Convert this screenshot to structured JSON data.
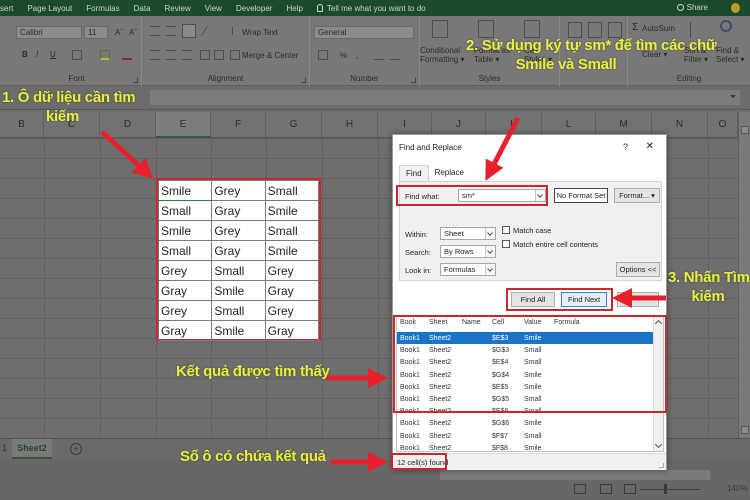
{
  "menubar": {
    "tabs": [
      "sert",
      "Page Layout",
      "Formulas",
      "Data",
      "Review",
      "View",
      "Developer",
      "Help"
    ],
    "tell_me": "Tell me what you want to do",
    "share": "Share"
  },
  "ribbon": {
    "font": {
      "name": "Calibri",
      "size": "11",
      "group_label": "Font",
      "bold": "B",
      "italic": "I",
      "underline": "U",
      "grow": "Aˆ",
      "shrink": "Aˇ"
    },
    "alignment": {
      "wrap_text": "Wrap Text",
      "merge_center": "Merge & Center",
      "group_label": "Alignment"
    },
    "number": {
      "format": "General",
      "percent": "%",
      "comma": ",",
      "group_label": "Number"
    },
    "styles": {
      "conditional_formatting": [
        "Conditional",
        "Formatting ▾"
      ],
      "format_as_table": [
        "Format as",
        "Table ▾"
      ],
      "cell_styles": [
        "Cell",
        "Styles ▾"
      ],
      "group_label": "Styles"
    },
    "editing": {
      "autosum": "AutoSum",
      "clear": "Clear ▾",
      "sort_filter": [
        "Sort &",
        "Filter ▾"
      ],
      "find_select": [
        "Find &",
        "Select ▾"
      ],
      "group_label": "Editing"
    }
  },
  "grid": {
    "columns": [
      "B",
      "C",
      "D",
      "E",
      "F",
      "G",
      "H",
      "I",
      "J",
      "K",
      "L",
      "M",
      "N",
      "O"
    ],
    "selected_column": "E",
    "data": [
      [
        "Smile",
        "Grey",
        "Small"
      ],
      [
        "Small",
        "Gray",
        "Smile"
      ],
      [
        "Smile",
        "Grey",
        "Small"
      ],
      [
        "Small",
        "Gray",
        "Smile"
      ],
      [
        "Grey",
        "Small",
        "Grey"
      ],
      [
        "Gray",
        "Smile",
        "Gray"
      ],
      [
        "Grey",
        "Small",
        "Grey"
      ],
      [
        "Gray",
        "Smile",
        "Gray"
      ]
    ]
  },
  "sheet_tabs": {
    "active": "Sheet2",
    "prev_fragment": "1",
    "add": "+"
  },
  "status": {
    "zoom": "140%"
  },
  "dialog": {
    "title": "Find and Replace",
    "help": "?",
    "close": "✕",
    "tabs": [
      "Find",
      "Replace"
    ],
    "active_tab": "Find",
    "find_what_label": "Find what:",
    "find_what_value": "sm*",
    "no_format_set": "No Format Set",
    "format_button": "Format...",
    "within_label": "Within:",
    "within_value": "Sheet",
    "search_label": "Search:",
    "search_value": "By Rows",
    "look_in_label": "Look in:",
    "look_in_value": "Formulas",
    "match_case": "Match case",
    "match_entire": "Match entire cell contents",
    "options_button": "Options <<",
    "find_all": "Find All",
    "find_next": "Find Next",
    "results": {
      "headers": [
        "Book",
        "Sheet",
        "Name",
        "Cell",
        "Value",
        "Formula"
      ],
      "rows": [
        [
          "Book1",
          "Sheet2",
          "",
          "$E$3",
          "Smile",
          ""
        ],
        [
          "Book1",
          "Sheet2",
          "",
          "$G$3",
          "Small",
          ""
        ],
        [
          "Book1",
          "Sheet2",
          "",
          "$E$4",
          "Small",
          ""
        ],
        [
          "Book1",
          "Sheet2",
          "",
          "$G$4",
          "Smile",
          ""
        ],
        [
          "Book1",
          "Sheet2",
          "",
          "$E$5",
          "Smile",
          ""
        ],
        [
          "Book1",
          "Sheet2",
          "",
          "$G$5",
          "Small",
          ""
        ],
        [
          "Book1",
          "Sheet2",
          "",
          "$E$6",
          "Small",
          ""
        ],
        [
          "Book1",
          "Sheet2",
          "",
          "$G$6",
          "Smile",
          ""
        ],
        [
          "Book1",
          "Sheet2",
          "",
          "$F$7",
          "Small",
          ""
        ],
        [
          "Book1",
          "Sheet2",
          "",
          "$F$8",
          "Smile",
          ""
        ]
      ],
      "selected_index": 0
    },
    "status": "12 cell(s) found"
  },
  "annotations": {
    "step1": [
      "1. Ô dữ liệu cần tìm",
      "kiếm"
    ],
    "step2": [
      "2. Sử dụng ký tự sm* để tìm các chữ",
      "Smile và Small"
    ],
    "step3": [
      "3. Nhấn Tìm",
      "kiếm"
    ],
    "results_found": "Kết quả được tìm thấy",
    "cell_count": "Số ô có chứa kết quả"
  },
  "colors": {
    "annotation_text": "#e8f03a",
    "highlight_red": "#c8272c",
    "excel_green": "#1c4a2c",
    "selection_blue": "#1a73c6"
  }
}
